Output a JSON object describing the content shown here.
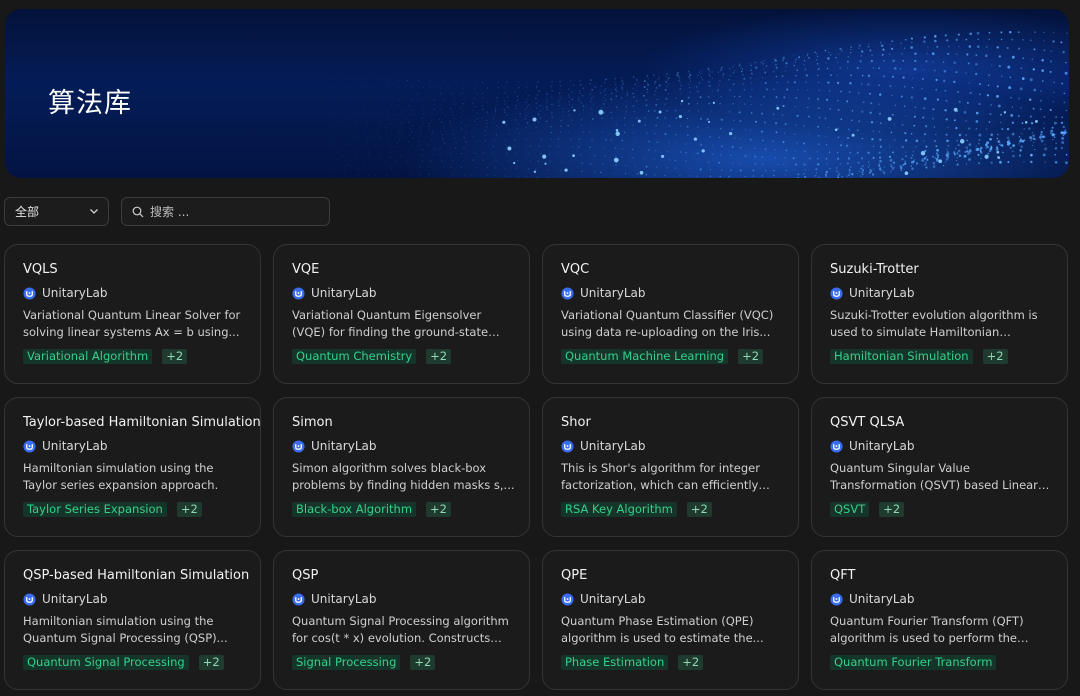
{
  "banner": {
    "title": "算法库"
  },
  "filter": {
    "selected": "全部"
  },
  "search": {
    "placeholder": "搜索 ..."
  },
  "cards": [
    {
      "title": "VQLS",
      "author": "UnitaryLab",
      "desc": "Variational Quantum Linear Solver for solving linear systems Ax = b using...",
      "tag": "Variational Algorithm",
      "more": "+2"
    },
    {
      "title": "VQE",
      "author": "UnitaryLab",
      "desc": "Variational Quantum Eigensolver (VQE) for finding the ground-state energy of a...",
      "tag": "Quantum Chemistry",
      "more": "+2"
    },
    {
      "title": "VQC",
      "author": "UnitaryLab",
      "desc": "Variational Quantum Classifier (VQC) using data re-uploading on the Iris...",
      "tag": "Quantum Machine Learning",
      "more": "+2"
    },
    {
      "title": "Suzuki-Trotter",
      "author": "UnitaryLab",
      "desc": "Suzuki-Trotter evolution algorithm is used to simulate Hamiltonian evolution e^{-...",
      "tag": "Hamiltonian Simulation",
      "more": "+2"
    },
    {
      "title": "Taylor-based Hamiltonian Simulation",
      "author": "UnitaryLab",
      "desc": "Hamiltonian simulation using the Taylor series expansion approach.",
      "tag": "Taylor Series Expansion",
      "more": "+2"
    },
    {
      "title": "Simon",
      "author": "UnitaryLab",
      "desc": "Simon algorithm solves black-box problems by finding hidden masks s,...",
      "tag": "Black-box Algorithm",
      "more": "+2"
    },
    {
      "title": "Shor",
      "author": "UnitaryLab",
      "desc": "This is Shor's algorithm for integer factorization, which can efficiently factor...",
      "tag": "RSA Key Algorithm",
      "more": "+2"
    },
    {
      "title": "QSVT QLSA",
      "author": "UnitaryLab",
      "desc": "Quantum Singular Value Transformation (QSVT) based Linear System Solver (QLS...",
      "tag": "QSVT",
      "more": "+2"
    },
    {
      "title": "QSP-based Hamiltonian Simulation",
      "author": "UnitaryLab",
      "desc": "Hamiltonian simulation using the Quantum Signal Processing (QSP)...",
      "tag": "Quantum Signal Processing",
      "more": "+2"
    },
    {
      "title": "QSP",
      "author": "UnitaryLab",
      "desc": "Quantum Signal Processing algorithm for cos(t * x) evolution. Constructs polynomi...",
      "tag": "Signal Processing",
      "more": "+2"
    },
    {
      "title": "QPE",
      "author": "UnitaryLab",
      "desc": "Quantum Phase Estimation (QPE) algorithm is used to estimate the...",
      "tag": "Phase Estimation",
      "more": "+2"
    },
    {
      "title": "QFT",
      "author": "UnitaryLab",
      "desc": "Quantum Fourier Transform (QFT) algorithm is used to perform the quantu...",
      "tag": "Quantum Fourier Transform",
      "more": ""
    }
  ],
  "colors": {
    "tag_text": "#36d08a",
    "tag_bg": "#16352a",
    "logo": "#3a6cf0"
  },
  "icons": {
    "search": "search-icon",
    "chevron": "chevron-down-icon",
    "logo": "unitarylab-logo-icon"
  }
}
